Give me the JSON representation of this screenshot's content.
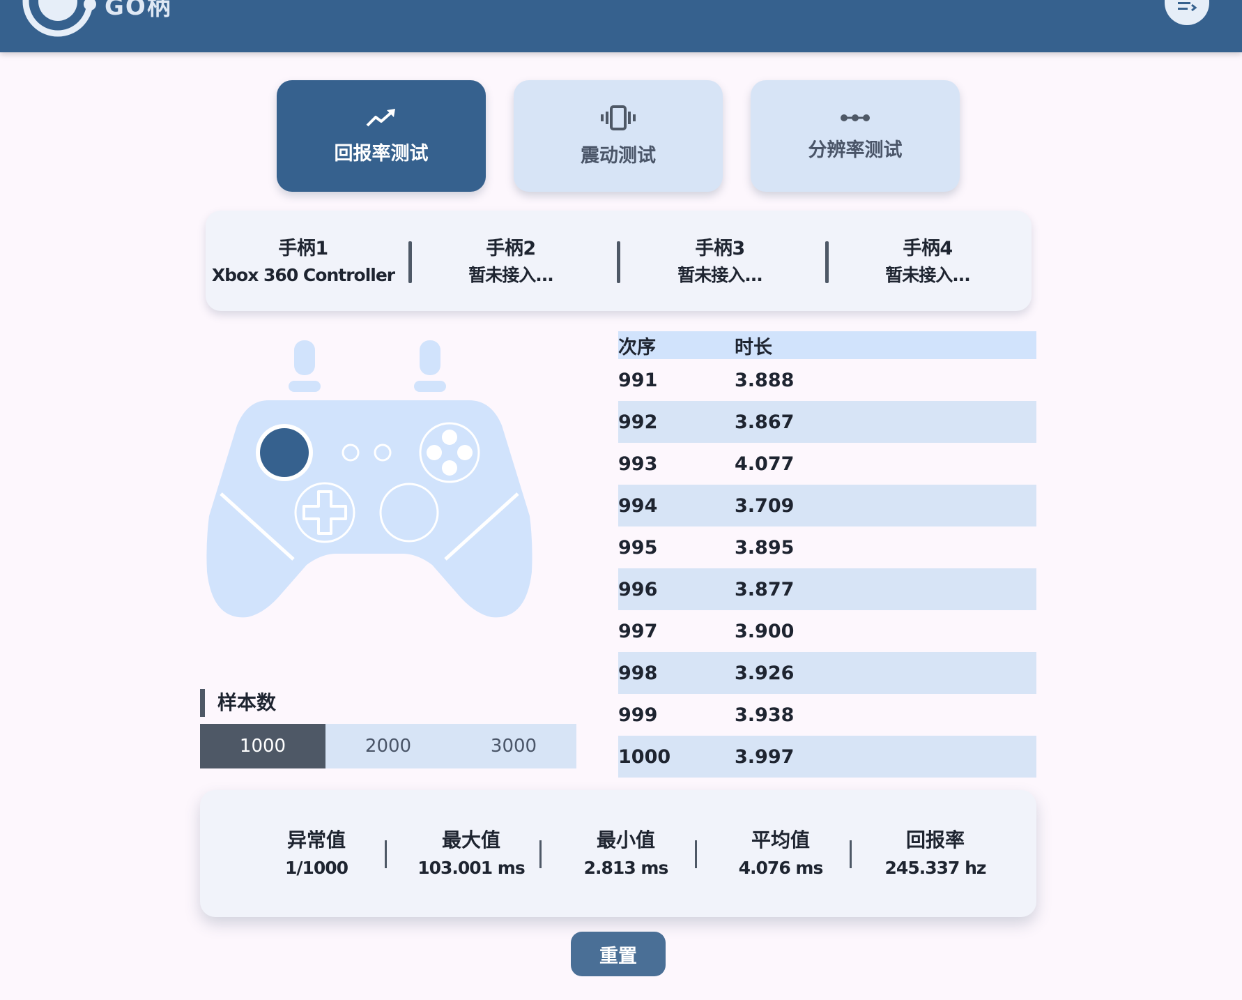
{
  "app": {
    "logo_text": "GO柄"
  },
  "modes": [
    {
      "label": "回报率测试",
      "icon": "trending-up-icon",
      "active": true
    },
    {
      "label": "震动测试",
      "icon": "vibration-icon",
      "active": false
    },
    {
      "label": "分辨率测试",
      "icon": "dots-icon",
      "active": false
    }
  ],
  "controllers": [
    {
      "name": "手柄1",
      "device": "Xbox 360 Controller"
    },
    {
      "name": "手柄2",
      "device": "暂未接入..."
    },
    {
      "name": "手柄3",
      "device": "暂未接入..."
    },
    {
      "name": "手柄4",
      "device": "暂未接入..."
    }
  ],
  "samples": {
    "title": "样本数",
    "options": [
      "1000",
      "2000",
      "3000"
    ],
    "selected": "1000"
  },
  "table": {
    "headers": [
      "次序",
      "时长"
    ],
    "rows": [
      [
        "991",
        "3.888"
      ],
      [
        "992",
        "3.867"
      ],
      [
        "993",
        "4.077"
      ],
      [
        "994",
        "3.709"
      ],
      [
        "995",
        "3.895"
      ],
      [
        "996",
        "3.877"
      ],
      [
        "997",
        "3.900"
      ],
      [
        "998",
        "3.926"
      ],
      [
        "999",
        "3.938"
      ],
      [
        "1000",
        "3.997"
      ]
    ]
  },
  "stats": [
    {
      "label": "异常值",
      "value": "1/1000"
    },
    {
      "label": "最大值",
      "value": "103.001 ms"
    },
    {
      "label": "最小值",
      "value": "2.813 ms"
    },
    {
      "label": "平均值",
      "value": "4.076 ms"
    },
    {
      "label": "回报率",
      "value": "245.337 hz"
    }
  ],
  "reset_label": "重置",
  "colors": {
    "primary": "#36618e",
    "tint": "#d7e4f6",
    "gamepad": "#d1e3fc",
    "active_stick": "#36618e",
    "dark": "#4e5866"
  }
}
